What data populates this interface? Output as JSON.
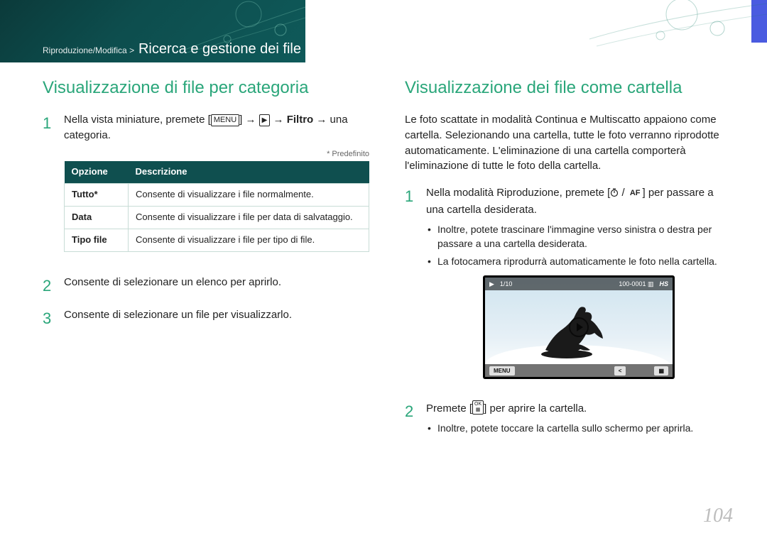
{
  "breadcrumb": {
    "path": "Riproduzione/Modifica >",
    "title": "Ricerca e gestione dei file"
  },
  "left": {
    "heading": "Visualizzazione di file per categoria",
    "step1_a": "Nella vista miniature, premete [",
    "step1_menu": "MENU",
    "step1_b": "] → ",
    "step1_c": " → ",
    "step1_filter": "Filtro",
    "step1_d": " → una categoria.",
    "predef": "* Predefinito",
    "table": {
      "h1": "Opzione",
      "h2": "Descrizione",
      "rows": [
        {
          "o": "Tutto*",
          "d": "Consente di visualizzare i file normalmente."
        },
        {
          "o": "Data",
          "d": "Consente di visualizzare i file per data di salvataggio."
        },
        {
          "o": "Tipo file",
          "d": "Consente di visualizzare i file per tipo di file."
        }
      ]
    },
    "step2": "Consente di selezionare un elenco per aprirlo.",
    "step3": "Consente di selezionare un file per visualizzarlo."
  },
  "right": {
    "heading": "Visualizzazione dei file come cartella",
    "intro": "Le foto scattate in modalità Continua e Multiscatto appaiono come cartella. Selezionando una cartella, tutte le foto verranno riprodotte automaticamente. L'eliminazione di una cartella comporterà l'eliminazione di tutte le foto della cartella.",
    "step1_a": "Nella modalità Riproduzione, premete [",
    "step1_af": "AF",
    "step1_b": "] per passare a una cartella desiderata.",
    "bullets1": [
      "Inoltre, potete trascinare l'immagine verso sinistra o destra per passare a una cartella desiderata.",
      "La fotocamera riprodurrà automaticamente le foto nella cartella."
    ],
    "shot": {
      "counter": "1/10",
      "fileno": "100-0001",
      "hs": "HS",
      "menu": "MENU"
    },
    "step2_a": "Premete [",
    "step2_ok": "OK",
    "step2_b": "] per aprire la cartella.",
    "bullets2": [
      "Inoltre, potete toccare la cartella sullo schermo per aprirla."
    ]
  },
  "page_number": "104"
}
